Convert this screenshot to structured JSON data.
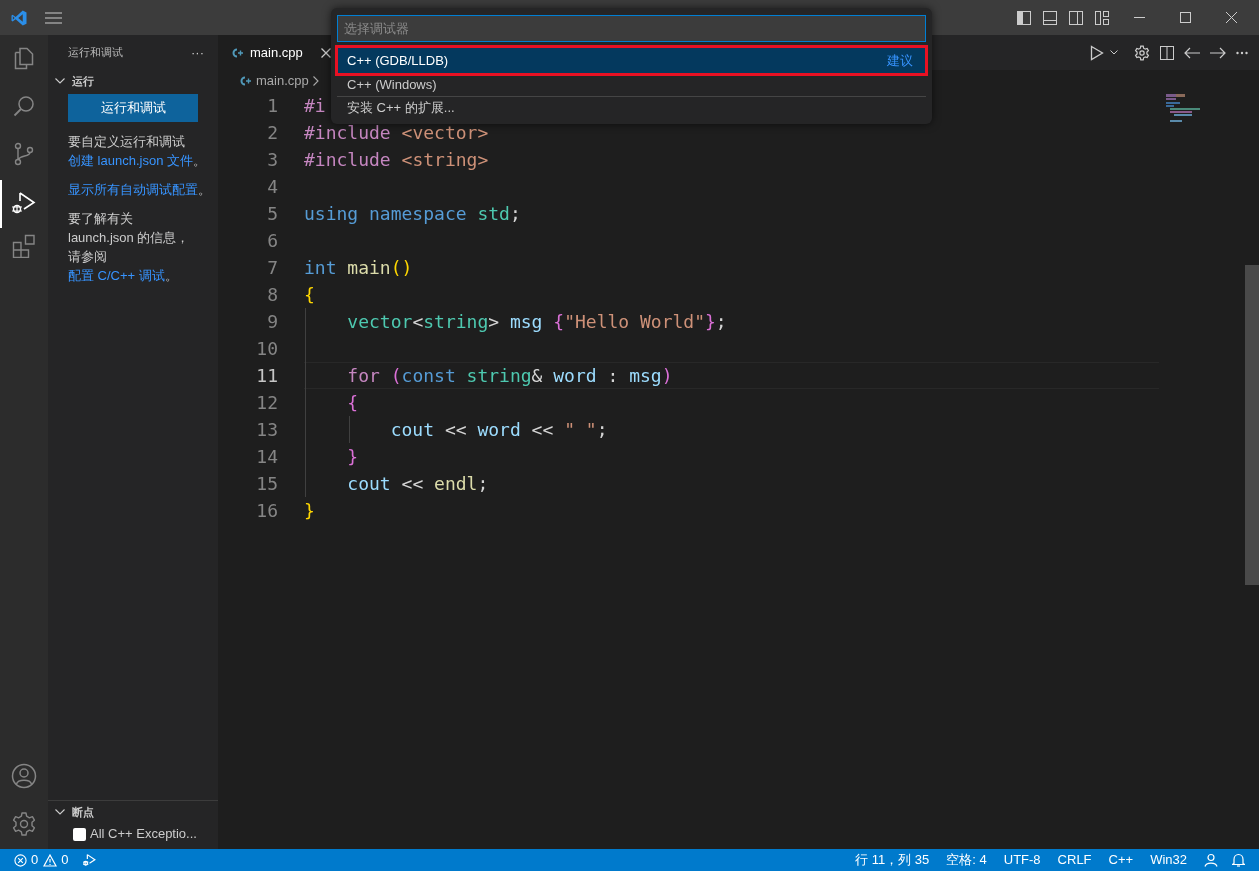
{
  "sidebar": {
    "title": "运行和调试",
    "more": "···",
    "section": {
      "title": "运行",
      "expanded": true
    },
    "run_button": "运行和调试",
    "paragraphs": [
      [
        {
          "text": "要自定义运行和调试",
          "link": false
        },
        {
          "text": "创建 launch.json 文件",
          "link": true
        },
        {
          "text": "。",
          "link": false
        }
      ],
      [
        {
          "text": "显示所有自动调试配置",
          "link": true
        },
        {
          "text": "。",
          "link": false
        }
      ],
      [
        {
          "text": "要了解有关 launch.json 的信息，请参阅 ",
          "link": false
        },
        {
          "text": "配置 C/C++ 调试",
          "link": true
        },
        {
          "text": "。",
          "link": false
        }
      ]
    ],
    "breakpoints": {
      "title": "断点",
      "expanded": true,
      "items": [
        {
          "label": "All C++ Exceptio...",
          "checked": false
        }
      ]
    }
  },
  "tabs": [
    {
      "label": "main.cpp",
      "selected": true
    }
  ],
  "breadcrumb": [
    "main.cpp"
  ],
  "code_lines": [
    {
      "number": "1",
      "current": false,
      "tokens": [
        {
          "text": "#i",
          "kind": "directive"
        }
      ]
    },
    {
      "number": "2",
      "current": false,
      "tokens": [
        {
          "text": "#include",
          "kind": "directive"
        },
        {
          "text": " <vector>",
          "kind": "string"
        }
      ]
    },
    {
      "number": "3",
      "current": false,
      "tokens": [
        {
          "text": "#include",
          "kind": "directive"
        },
        {
          "text": " <string>",
          "kind": "string"
        }
      ]
    },
    {
      "number": "4",
      "current": false
    },
    {
      "number": "5",
      "current": false,
      "tokens": [
        {
          "text": "using",
          "kind": "keyword"
        },
        {
          "text": " namespace",
          "kind": "keyword"
        },
        {
          "text": " std",
          "kind": "type"
        },
        {
          "text": ";",
          "kind": "plain"
        }
      ]
    },
    {
      "number": "6",
      "current": false
    },
    {
      "number": "7",
      "current": false,
      "tokens": [
        {
          "text": "int",
          "kind": "keyword"
        },
        {
          "text": " main",
          "kind": "function"
        },
        {
          "text": "()",
          "kind": "bracket1"
        }
      ]
    },
    {
      "number": "8",
      "current": false,
      "tokens": [
        {
          "text": "{",
          "kind": "bracket1"
        }
      ]
    },
    {
      "number": "9",
      "current": false,
      "tokens": [
        {
          "text": "    vector",
          "kind": "type"
        },
        {
          "text": "<",
          "kind": "plain"
        },
        {
          "text": "string",
          "kind": "type"
        },
        {
          "text": ">",
          "kind": "plain"
        },
        {
          "text": " msg ",
          "kind": "variable"
        },
        {
          "text": "{",
          "kind": "bracket2"
        },
        {
          "text": "\"Hello World\"",
          "kind": "string"
        },
        {
          "text": "}",
          "kind": "bracket2"
        },
        {
          "text": ";",
          "kind": "plain"
        }
      ]
    },
    {
      "number": "10",
      "current": false
    },
    {
      "number": "11",
      "current": true,
      "tokens": [
        {
          "text": "    for",
          "kind": "control"
        },
        {
          "text": " (",
          "kind": "bracket2"
        },
        {
          "text": "const",
          "kind": "keyword"
        },
        {
          "text": " string",
          "kind": "type"
        },
        {
          "text": "&",
          "kind": "plain"
        },
        {
          "text": " word",
          "kind": "variable"
        },
        {
          "text": " : ",
          "kind": "plain"
        },
        {
          "text": "msg",
          "kind": "variable"
        },
        {
          "text": ")",
          "kind": "bracket2"
        }
      ]
    },
    {
      "number": "12",
      "current": false,
      "tokens": [
        {
          "text": "    {",
          "kind": "bracket2"
        }
      ]
    },
    {
      "number": "13",
      "current": false,
      "tokens": [
        {
          "text": "        cout",
          "kind": "variable"
        },
        {
          "text": " << ",
          "kind": "plain"
        },
        {
          "text": "word",
          "kind": "variable"
        },
        {
          "text": " << ",
          "kind": "plain"
        },
        {
          "text": "\" \"",
          "kind": "string"
        },
        {
          "text": ";",
          "kind": "plain"
        }
      ]
    },
    {
      "number": "14",
      "current": false,
      "tokens": [
        {
          "text": "    }",
          "kind": "bracket2"
        }
      ]
    },
    {
      "number": "15",
      "current": false,
      "tokens": [
        {
          "text": "    cout",
          "kind": "variable"
        },
        {
          "text": " << ",
          "kind": "plain"
        },
        {
          "text": "endl",
          "kind": "function"
        },
        {
          "text": ";",
          "kind": "plain"
        }
      ]
    },
    {
      "number": "16",
      "current": false,
      "tokens": [
        {
          "text": "}",
          "kind": "bracket1"
        }
      ]
    }
  ],
  "quick_pick": {
    "placeholder": "选择调试器",
    "items": [
      {
        "label": "C++ (GDB/LLDB)",
        "badge": "建议",
        "selected": true,
        "highlighted": true
      },
      {
        "label": "C++ (Windows)",
        "selected": false,
        "highlighted": false
      },
      {
        "label": "安装 C++ 的扩展...",
        "selected": false,
        "highlighted": false
      }
    ]
  },
  "status_bar": {
    "errors": "0",
    "warnings": "0",
    "right": [
      "行 11，列 35",
      "空格: 4",
      "UTF-8",
      "CRLF",
      "C++",
      "Win32"
    ]
  }
}
